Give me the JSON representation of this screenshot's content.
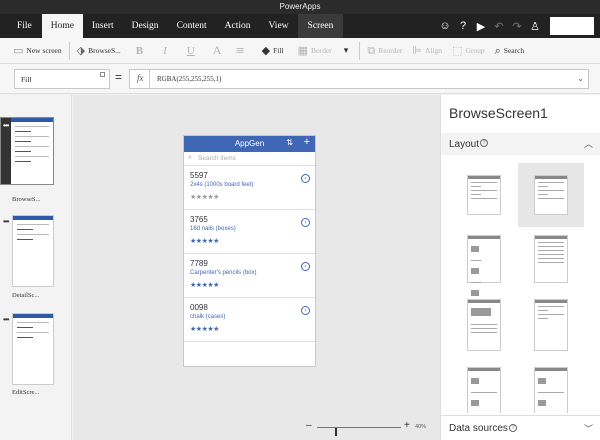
{
  "app": {
    "title": "PowerApps"
  },
  "menu": {
    "tabs": [
      {
        "label": "File"
      },
      {
        "label": "Home"
      },
      {
        "label": "Insert"
      },
      {
        "label": "Design"
      },
      {
        "label": "Content"
      },
      {
        "label": "Action"
      },
      {
        "label": "View"
      },
      {
        "label": "Screen"
      }
    ]
  },
  "ribbon": {
    "new_screen": "New screen",
    "browse_screen": "BrowseS...",
    "bold": "B",
    "italic": "I",
    "underline": "U",
    "font": "A",
    "fill": "Fill",
    "border": "Border",
    "reorder": "Reorder",
    "align": "Align",
    "group": "Group",
    "search": "Search"
  },
  "formula": {
    "property": "Fill",
    "equals": "=",
    "fx": "fx",
    "value": "RGBA(255,255,255,1)"
  },
  "screens": [
    {
      "label": "BrowseS..."
    },
    {
      "label": "DetailSc..."
    },
    {
      "label": "EditScre..."
    }
  ],
  "phone": {
    "title": "AppGen",
    "search_placeholder": "Search items",
    "items": [
      {
        "number": "5597",
        "name": "2x4s (1000s board feet)",
        "rating": 0
      },
      {
        "number": "3765",
        "name": "16d nails (boxes)",
        "rating": 5
      },
      {
        "number": "7789",
        "name": "Carpenter's pencils (box)",
        "rating": 5
      },
      {
        "number": "0098",
        "name": "chalk (cases)",
        "rating": 5
      }
    ]
  },
  "zoom": {
    "value": 0.4,
    "label": "40%"
  },
  "properties": {
    "title": "BrowseScreen1",
    "layout_label": "Layout",
    "data_sources_label": "Data sources"
  }
}
